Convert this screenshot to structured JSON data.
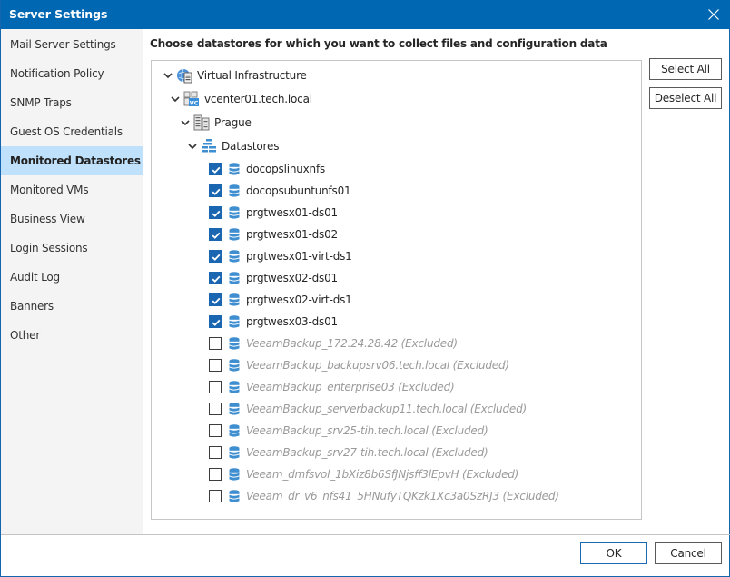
{
  "window": {
    "title": "Server Settings",
    "close_label": "Close"
  },
  "sidebar": {
    "items": [
      {
        "label": "Mail Server Settings",
        "active": false
      },
      {
        "label": "Notification Policy",
        "active": false
      },
      {
        "label": "SNMP Traps",
        "active": false
      },
      {
        "label": "Guest OS Credentials",
        "active": false
      },
      {
        "label": "Monitored Datastores",
        "active": true
      },
      {
        "label": "Monitored VMs",
        "active": false
      },
      {
        "label": "Business View",
        "active": false
      },
      {
        "label": "Login Sessions",
        "active": false
      },
      {
        "label": "Audit Log",
        "active": false
      },
      {
        "label": "Banners",
        "active": false
      },
      {
        "label": "Other",
        "active": false
      }
    ]
  },
  "main": {
    "heading": "Choose datastores for which you want to collect files and configuration data",
    "tree": {
      "root": {
        "label": "Virtual Infrastructure",
        "icon": "virtual-infrastructure-icon",
        "expanded": true
      },
      "vcenter": {
        "label": "vcenter01.tech.local",
        "icon": "vcenter-icon",
        "expanded": true
      },
      "datacenter": {
        "label": "Prague",
        "icon": "datacenter-icon",
        "expanded": true
      },
      "folder": {
        "label": "Datastores",
        "icon": "datastores-folder-icon",
        "expanded": true
      },
      "datastores": [
        {
          "label": "docopslinuxnfs",
          "checked": true,
          "excluded": false
        },
        {
          "label": "docopsubuntunfs01",
          "checked": true,
          "excluded": false
        },
        {
          "label": "prgtwesx01-ds01",
          "checked": true,
          "excluded": false
        },
        {
          "label": "prgtwesx01-ds02",
          "checked": true,
          "excluded": false
        },
        {
          "label": "prgtwesx01-virt-ds1",
          "checked": true,
          "excluded": false
        },
        {
          "label": "prgtwesx02-ds01",
          "checked": true,
          "excluded": false
        },
        {
          "label": "prgtwesx02-virt-ds1",
          "checked": true,
          "excluded": false
        },
        {
          "label": "prgtwesx03-ds01",
          "checked": true,
          "excluded": false
        },
        {
          "label": "VeeamBackup_172.24.28.42 (Excluded)",
          "checked": false,
          "excluded": true
        },
        {
          "label": "VeeamBackup_backupsrv06.tech.local (Excluded)",
          "checked": false,
          "excluded": true
        },
        {
          "label": "VeeamBackup_enterprise03 (Excluded)",
          "checked": false,
          "excluded": true
        },
        {
          "label": "VeeamBackup_serverbackup11.tech.local (Excluded)",
          "checked": false,
          "excluded": true
        },
        {
          "label": "VeeamBackup_srv25-tih.tech.local (Excluded)",
          "checked": false,
          "excluded": true
        },
        {
          "label": "VeeamBackup_srv27-tih.tech.local (Excluded)",
          "checked": false,
          "excluded": true
        },
        {
          "label": "Veeam_dmfsvol_1bXiz8b6SfJNjsff3lEpvH (Excluded)",
          "checked": false,
          "excluded": true
        },
        {
          "label": "Veeam_dr_v6_nfs41_5HNufyTQKzk1Xc3a0SzRJ3 (Excluded)",
          "checked": false,
          "excluded": true
        }
      ]
    },
    "buttons": {
      "select_all": "Select All",
      "deselect_all": "Deselect All"
    }
  },
  "footer": {
    "ok": "OK",
    "cancel": "Cancel"
  },
  "colors": {
    "title_bar": "#0068b3",
    "active_nav": "#bfe1fb",
    "checkbox_checked": "#1a66b0",
    "datastore_icon": "#3e8ed0",
    "excluded_text": "#9a9a9a"
  }
}
